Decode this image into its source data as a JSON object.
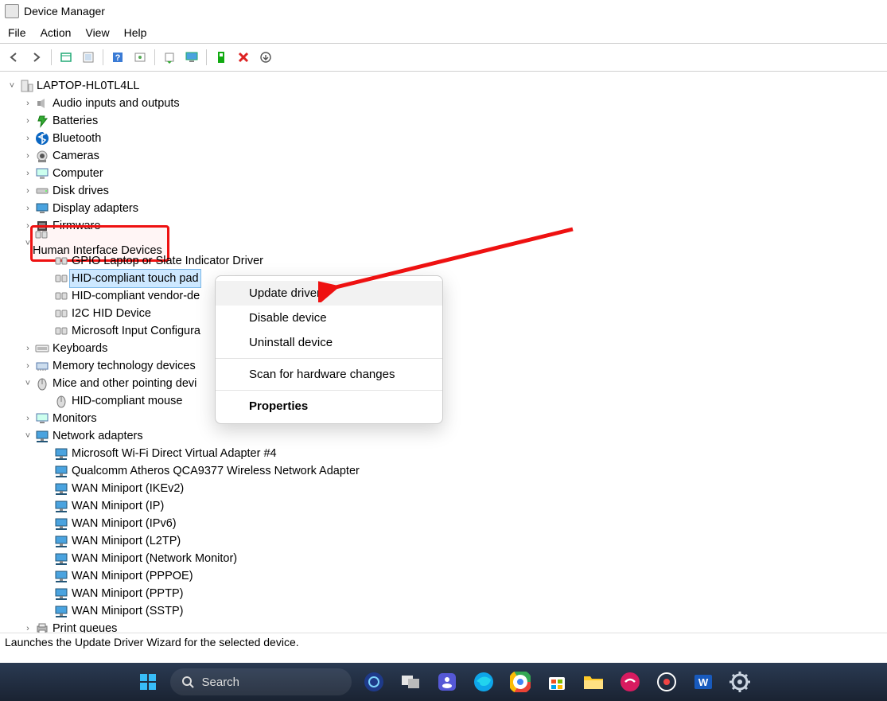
{
  "window": {
    "title": "Device Manager"
  },
  "menubar": [
    "File",
    "Action",
    "View",
    "Help"
  ],
  "toolbar_icons": [
    "back",
    "forward",
    "show-hidden",
    "properties",
    "help",
    "update",
    "scan",
    "monitor",
    "enable",
    "remove",
    "more"
  ],
  "root": {
    "label": "LAPTOP-HL0TL4LL"
  },
  "categories": [
    {
      "label": "Audio inputs and outputs",
      "exp": ">",
      "icon": "speaker"
    },
    {
      "label": "Batteries",
      "exp": ">",
      "icon": "battery"
    },
    {
      "label": "Bluetooth",
      "exp": ">",
      "icon": "bluetooth"
    },
    {
      "label": "Cameras",
      "exp": ">",
      "icon": "camera"
    },
    {
      "label": "Computer",
      "exp": ">",
      "icon": "computer"
    },
    {
      "label": "Disk drives",
      "exp": ">",
      "icon": "disk"
    },
    {
      "label": "Display adapters",
      "exp": ">",
      "icon": "display"
    },
    {
      "label": "Firmware",
      "exp": ">",
      "icon": "firmware"
    },
    {
      "label": "Human Interface Devices",
      "exp": "v",
      "icon": "hid",
      "highlight": true,
      "children": [
        {
          "label": "GPIO Laptop or Slate Indicator Driver"
        },
        {
          "label": "HID-compliant touch pad",
          "selected": true
        },
        {
          "label": "HID-compliant vendor-de"
        },
        {
          "label": "I2C HID Device"
        },
        {
          "label": "Microsoft Input Configura"
        }
      ]
    },
    {
      "label": "Keyboards",
      "exp": ">",
      "icon": "keyboard"
    },
    {
      "label": "Memory technology devices",
      "exp": ">",
      "icon": "memory"
    },
    {
      "label": "Mice and other pointing devi",
      "exp": "v",
      "icon": "mouse",
      "children": [
        {
          "label": "HID-compliant mouse"
        }
      ]
    },
    {
      "label": "Monitors",
      "exp": ">",
      "icon": "monitor"
    },
    {
      "label": "Network adapters",
      "exp": "v",
      "icon": "net",
      "children": [
        {
          "label": "Microsoft Wi-Fi Direct Virtual Adapter #4"
        },
        {
          "label": "Qualcomm Atheros QCA9377 Wireless Network Adapter"
        },
        {
          "label": "WAN Miniport (IKEv2)"
        },
        {
          "label": "WAN Miniport (IP)"
        },
        {
          "label": "WAN Miniport (IPv6)"
        },
        {
          "label": "WAN Miniport (L2TP)"
        },
        {
          "label": "WAN Miniport (Network Monitor)"
        },
        {
          "label": "WAN Miniport (PPPOE)"
        },
        {
          "label": "WAN Miniport (PPTP)"
        },
        {
          "label": "WAN Miniport (SSTP)"
        }
      ]
    },
    {
      "label": "Print queues",
      "exp": ">",
      "icon": "printer"
    }
  ],
  "context_menu": {
    "items": [
      {
        "label": "Update driver",
        "hl": true
      },
      {
        "label": "Disable device"
      },
      {
        "label": "Uninstall device"
      },
      {
        "sep": true
      },
      {
        "label": "Scan for hardware changes"
      },
      {
        "sep": true
      },
      {
        "label": "Properties",
        "bold": true
      }
    ]
  },
  "status_text": "Launches the Update Driver Wizard for the selected device.",
  "taskbar": {
    "search_placeholder": "Search",
    "items": [
      "start",
      "search",
      "copilot",
      "taskview",
      "chat",
      "edge",
      "chrome",
      "store",
      "explorer",
      "app1",
      "app2",
      "word",
      "settings"
    ]
  }
}
